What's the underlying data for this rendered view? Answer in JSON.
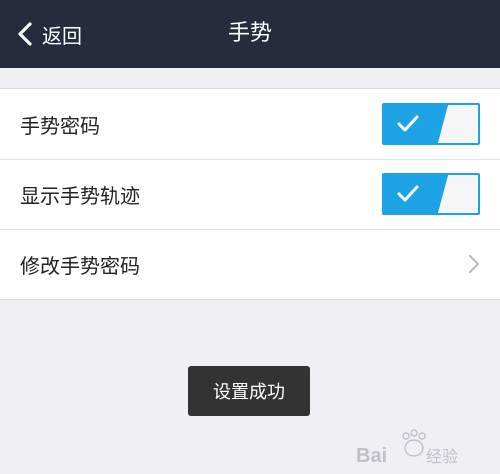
{
  "nav": {
    "back_label": "返回",
    "title": "手势"
  },
  "settings": {
    "rows": [
      {
        "label": "手势密码",
        "control": "toggle",
        "on": true
      },
      {
        "label": "显示手势轨迹",
        "control": "toggle",
        "on": true
      },
      {
        "label": "修改手势密码",
        "control": "disclosure"
      }
    ]
  },
  "toast": {
    "message": "设置成功"
  },
  "watermark": {
    "brand": "Baidu 经验"
  },
  "colors": {
    "nav_bg": "#262b3d",
    "accent": "#1ea2e6",
    "page_bg": "#efeff4"
  },
  "icons": {
    "back": "chevron-left-icon",
    "toggle_on": "check-icon",
    "disclosure": "chevron-right-icon"
  }
}
